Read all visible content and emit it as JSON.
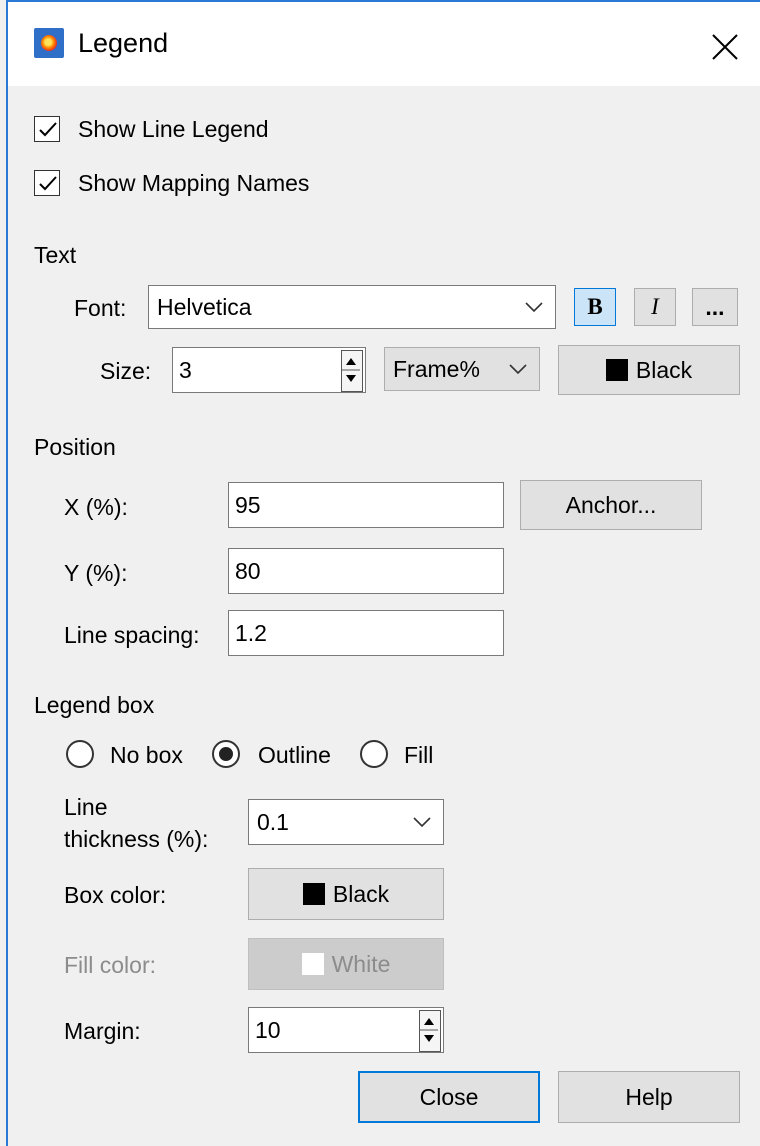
{
  "window": {
    "title": "Legend"
  },
  "options": {
    "show_line_legend": {
      "label": "Show Line Legend",
      "checked": true
    },
    "show_mapping_names": {
      "label": "Show Mapping Names",
      "checked": true
    }
  },
  "text_section": {
    "heading": "Text",
    "font_label": "Font:",
    "font_value": "Helvetica",
    "bold_label": "B",
    "italic_label": "I",
    "more_label": "...",
    "size_label": "Size:",
    "size_value": "3",
    "unit_value": "Frame%",
    "color_label": "Black",
    "color_hex": "#000000"
  },
  "position_section": {
    "heading": "Position",
    "x_label": "X (%):",
    "x_value": "95",
    "anchor_label": "Anchor...",
    "y_label": "Y (%):",
    "y_value": "80",
    "spacing_label": "Line spacing:",
    "spacing_value": "1.2"
  },
  "legend_box": {
    "heading": "Legend box",
    "radio_no_box": "No box",
    "radio_outline": "Outline",
    "radio_fill": "Fill",
    "selected": "Outline",
    "thickness_label_line1": "Line",
    "thickness_label_line2": "thickness (%):",
    "thickness_value": "0.1",
    "box_color_label": "Box color:",
    "box_color_value": "Black",
    "box_color_hex": "#000000",
    "fill_color_label": "Fill color:",
    "fill_color_value": "White",
    "fill_color_hex": "#ffffff",
    "margin_label": "Margin:",
    "margin_value": "10"
  },
  "footer": {
    "close_label": "Close",
    "help_label": "Help"
  },
  "colors": {
    "accent": "#0078d7"
  }
}
